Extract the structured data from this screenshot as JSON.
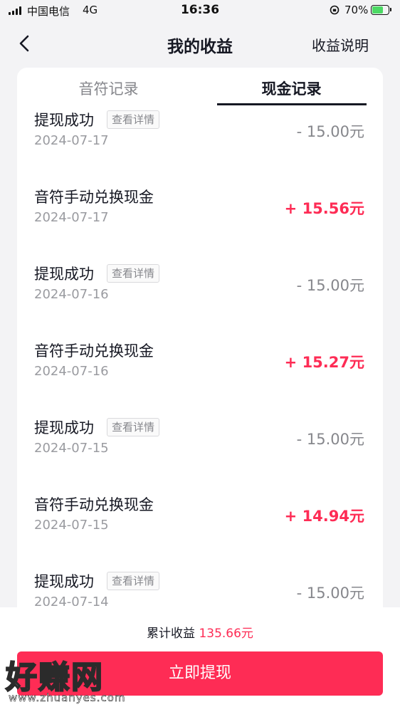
{
  "status_bar": {
    "carrier": "中国电信",
    "network": "4G",
    "time": "16:36",
    "battery_percent": "70%",
    "battery_level": 0.7
  },
  "header": {
    "title": "我的收益",
    "explain_label": "收益说明"
  },
  "tabs": {
    "notes_label": "音符记录",
    "cash_label": "现金记录",
    "active": "现金记录"
  },
  "detail_label": "查看详情",
  "records": [
    {
      "name": "提现成功",
      "date": "2024-07-17",
      "amount": "- 15.00元",
      "has_detail": true
    },
    {
      "name": "音符手动兑换现金",
      "date": "2024-07-17",
      "amount": "+ 15.56元",
      "has_detail": false
    },
    {
      "name": "提现成功",
      "date": "2024-07-16",
      "amount": "- 15.00元",
      "has_detail": true
    },
    {
      "name": "音符手动兑换现金",
      "date": "2024-07-16",
      "amount": "+ 15.27元",
      "has_detail": false
    },
    {
      "name": "提现成功",
      "date": "2024-07-15",
      "amount": "- 15.00元",
      "has_detail": true
    },
    {
      "name": "音符手动兑换现金",
      "date": "2024-07-15",
      "amount": "+ 14.94元",
      "has_detail": false
    },
    {
      "name": "提现成功",
      "date": "2024-07-14",
      "amount": "- 15.00元",
      "has_detail": true
    }
  ],
  "bottom": {
    "total_label": "累计收益",
    "total_value": "135.66元",
    "withdraw_label": "立即提现"
  },
  "watermark": {
    "text": "好赚网",
    "url": "www.zhuanyes.com"
  },
  "colors": {
    "accent": "#fe2c55",
    "text": "#161823",
    "muted": "#86878c"
  }
}
